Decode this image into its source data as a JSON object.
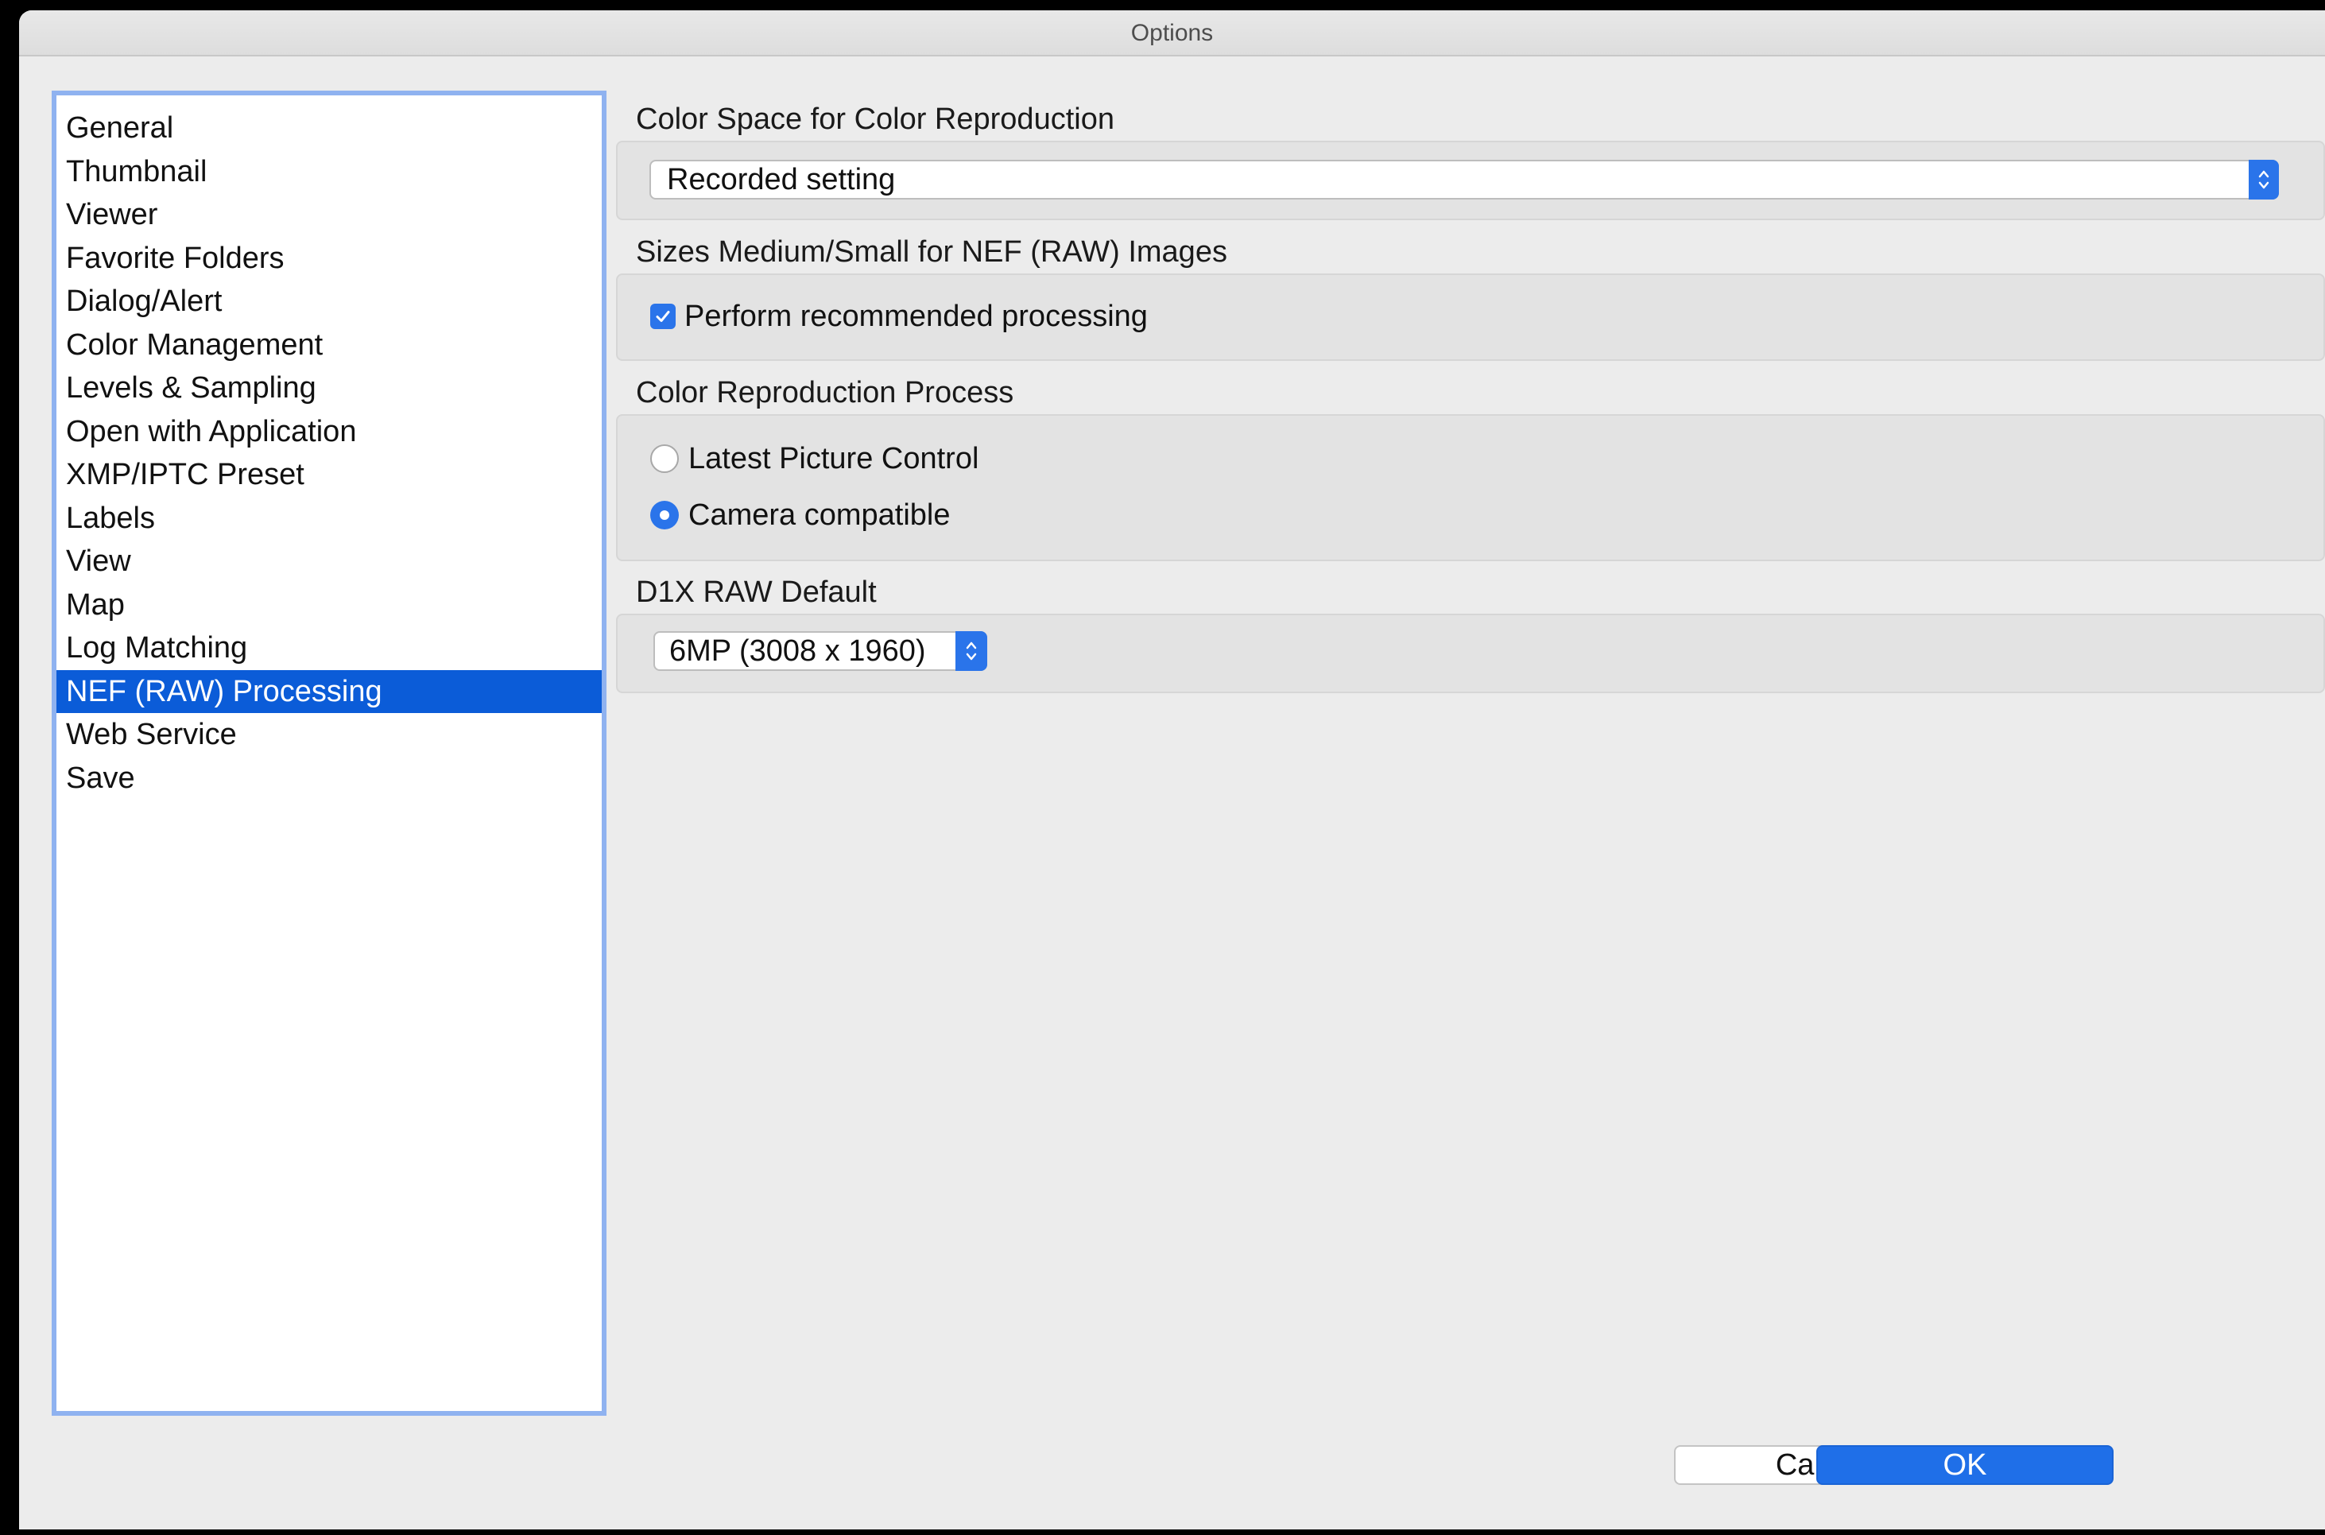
{
  "window": {
    "title": "Options"
  },
  "sidebar": {
    "items": [
      {
        "label": "General"
      },
      {
        "label": "Thumbnail"
      },
      {
        "label": "Viewer"
      },
      {
        "label": "Favorite Folders"
      },
      {
        "label": "Dialog/Alert"
      },
      {
        "label": "Color Management"
      },
      {
        "label": "Levels & Sampling"
      },
      {
        "label": "Open with Application"
      },
      {
        "label": "XMP/IPTC Preset"
      },
      {
        "label": "Labels"
      },
      {
        "label": "View"
      },
      {
        "label": "Map"
      },
      {
        "label": "Log Matching"
      },
      {
        "label": "NEF (RAW) Processing"
      },
      {
        "label": "Web Service"
      },
      {
        "label": "Save"
      }
    ],
    "selected": "NEF (RAW) Processing"
  },
  "color_space": {
    "title": "Color Space for Color Reproduction",
    "value": "Recorded setting",
    "arrow_icon": "up-down-chevron-icon"
  },
  "sizes": {
    "title": "Sizes Medium/Small for NEF (RAW) Images",
    "checkbox_label": "Perform recommended processing",
    "checked": true
  },
  "color_reproduction": {
    "title": "Color Reproduction Process",
    "options": [
      {
        "label": "Latest Picture Control",
        "selected": false
      },
      {
        "label": "Camera compatible",
        "selected": true
      }
    ]
  },
  "d1x_raw": {
    "title": "D1X RAW Default",
    "value": "6MP (3008 x 1960)",
    "arrow_icon": "up-down-chevron-icon"
  },
  "buttons": {
    "cancel": "Cancel",
    "ok": "OK"
  },
  "colors": {
    "accent": "#2a74ea",
    "selection": "#0b5cd8",
    "sidebar_border": "#8fb2f0",
    "window_bg": "#ececec",
    "group_bg": "#e3e3e3"
  }
}
